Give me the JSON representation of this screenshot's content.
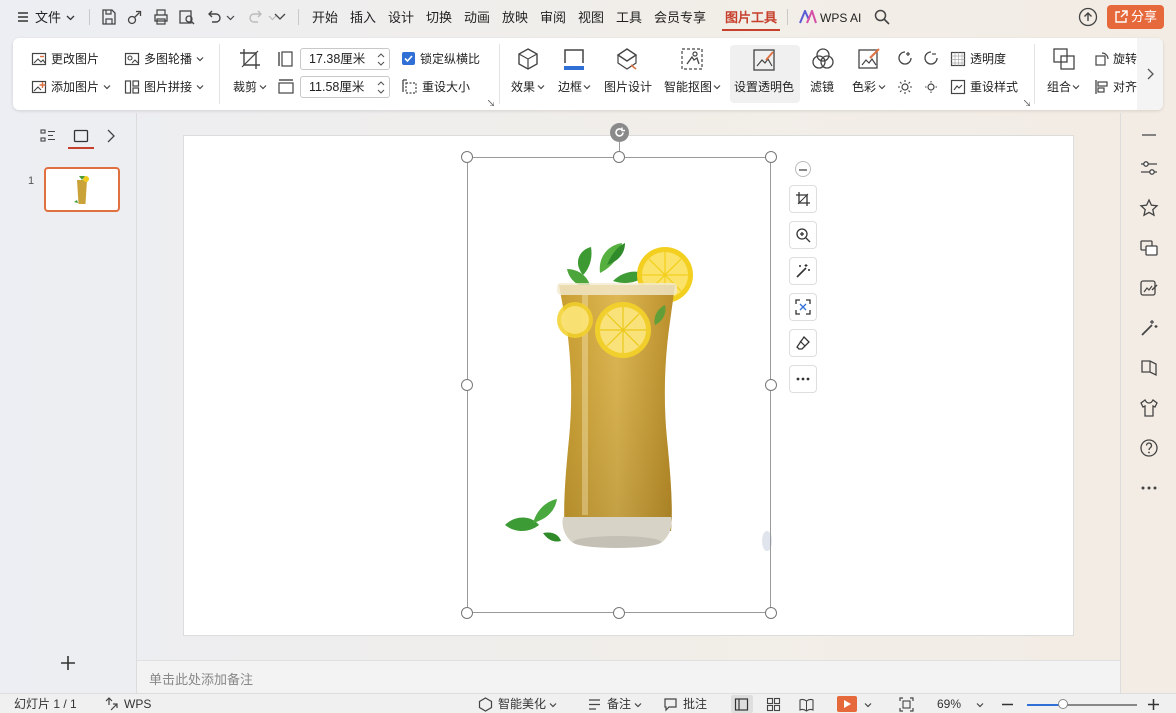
{
  "menubar": {
    "file_label": "文件",
    "tabs": [
      "开始",
      "插入",
      "设计",
      "切换",
      "动画",
      "放映",
      "审阅",
      "视图",
      "工具",
      "会员专享",
      "图片工具"
    ],
    "active_tab": "图片工具",
    "wps_ai_label": "WPS AI",
    "share_label": "分享"
  },
  "ribbon": {
    "change_picture": "更改图片",
    "multi_carousel": "多图轮播",
    "add_picture": "添加图片",
    "picture_mosaic": "图片拼接",
    "crop": "裁剪",
    "width_value": "17.38厘米",
    "height_value": "11.58厘米",
    "lock_ratio": "锁定纵横比",
    "reset_size": "重设大小",
    "effects": "效果",
    "border": "边框",
    "picture_design": "图片设计",
    "smart_cutout": "智能抠图",
    "set_transparent": "设置透明色",
    "filter": "滤镜",
    "color": "色彩",
    "transparency": "透明度",
    "reset_style": "重设样式",
    "group": "组合",
    "rotate": "旋转",
    "align": "对齐"
  },
  "slides": {
    "thumb_number": "1"
  },
  "notes": {
    "placeholder": "单击此处添加备注"
  },
  "statusbar": {
    "slide_info": "幻灯片 1 / 1",
    "theme": "WPS",
    "beautify": "智能美化",
    "notes": "备注",
    "comments": "批注",
    "zoom": "69%"
  },
  "colors": {
    "accent": "#c7402d",
    "share": "#e6693c",
    "checkbox": "#2f6fd6"
  }
}
